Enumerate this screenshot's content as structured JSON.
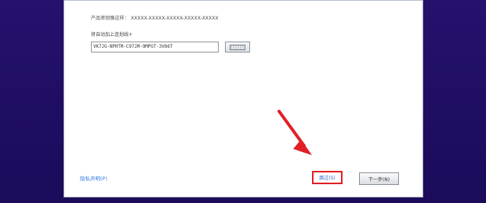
{
  "dialog": {
    "product_key_hint_label": "产品密钥像这样：",
    "product_key_format": "XXXXX-XXXXX-XXXXX-XXXXX-XXXXX",
    "auto_add_dashes_label": "将自动加上连划线+",
    "product_key_value": "VK7JG-NPHTM-C97JM-9MPGT-3V66T",
    "privacy_link_label": "隐私声明(P)",
    "skip_button_label": "跳过(S)",
    "next_button_label": "下一步(N)"
  },
  "annotations": {
    "highlight_color": "#e21f26",
    "arrow_color": "#e21f26"
  },
  "icons": {
    "keyboard": "keyboard-icon",
    "arrow": "red-arrow-icon"
  }
}
